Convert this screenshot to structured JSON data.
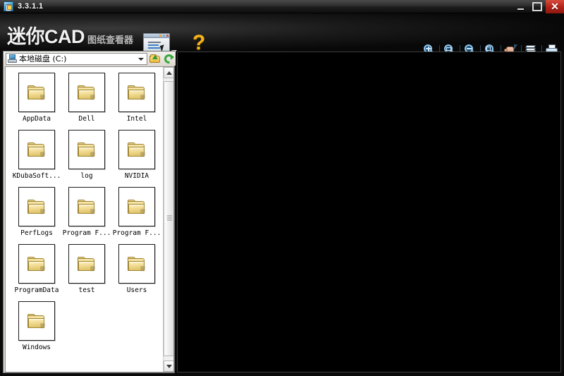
{
  "window": {
    "title": "3.3.1.1",
    "app_icon": "app-window-icon",
    "controls": {
      "minimize": "minimize-button",
      "maximize": "maximize-button",
      "close_glyph": "✕"
    }
  },
  "brand": {
    "logo_main": "迷你CAD",
    "logo_sub": "图纸查看器",
    "open_button": "open-file-button",
    "open_caret": "dropdown-caret",
    "help_glyph": "?"
  },
  "toolbar": {
    "items": [
      {
        "name": "zoom-in-icon",
        "title": "放大"
      },
      {
        "name": "zoom-window-icon",
        "title": "窗口缩放"
      },
      {
        "name": "zoom-out-icon",
        "title": "缩小"
      },
      {
        "name": "zoom-extents-icon",
        "title": "全图显示"
      },
      {
        "name": "pan-hand-icon",
        "title": "平移"
      },
      {
        "name": "layers-icon",
        "title": "图层"
      },
      {
        "name": "print-icon",
        "title": "打印"
      }
    ]
  },
  "browser": {
    "path_value": "本地磁盘 (C:)",
    "drive_icon": "drive-icon",
    "up_button": "folder-up-button",
    "refresh_button": "refresh-button",
    "combo_caret": "chevron-down-icon",
    "items": [
      {
        "label": "AppData",
        "type": "folder"
      },
      {
        "label": "Dell",
        "type": "folder"
      },
      {
        "label": "Intel",
        "type": "folder"
      },
      {
        "label": "KDubaSoft...",
        "type": "folder"
      },
      {
        "label": "log",
        "type": "folder"
      },
      {
        "label": "NVIDIA",
        "type": "folder"
      },
      {
        "label": "PerfLogs",
        "type": "folder"
      },
      {
        "label": "Program F...",
        "type": "folder"
      },
      {
        "label": "Program F...",
        "type": "folder"
      },
      {
        "label": "ProgramData",
        "type": "folder"
      },
      {
        "label": "test",
        "type": "folder"
      },
      {
        "label": "Users",
        "type": "folder"
      },
      {
        "label": "Windows",
        "type": "folder"
      }
    ],
    "scrollbar": {
      "up_arrow": "scroll-up-arrow",
      "down_arrow": "scroll-down-arrow",
      "thumb": "scroll-thumb"
    }
  },
  "canvas": {
    "name": "drawing-canvas",
    "background": "#000000",
    "content": ""
  },
  "colors": {
    "titlebar_text": "#ffffff",
    "close_red": "#b4241a",
    "help_yellow": "#f6b31c",
    "folder_yellow": "#e3c463",
    "panel_bg": "#d7d3cb",
    "canvas_black": "#000000"
  }
}
